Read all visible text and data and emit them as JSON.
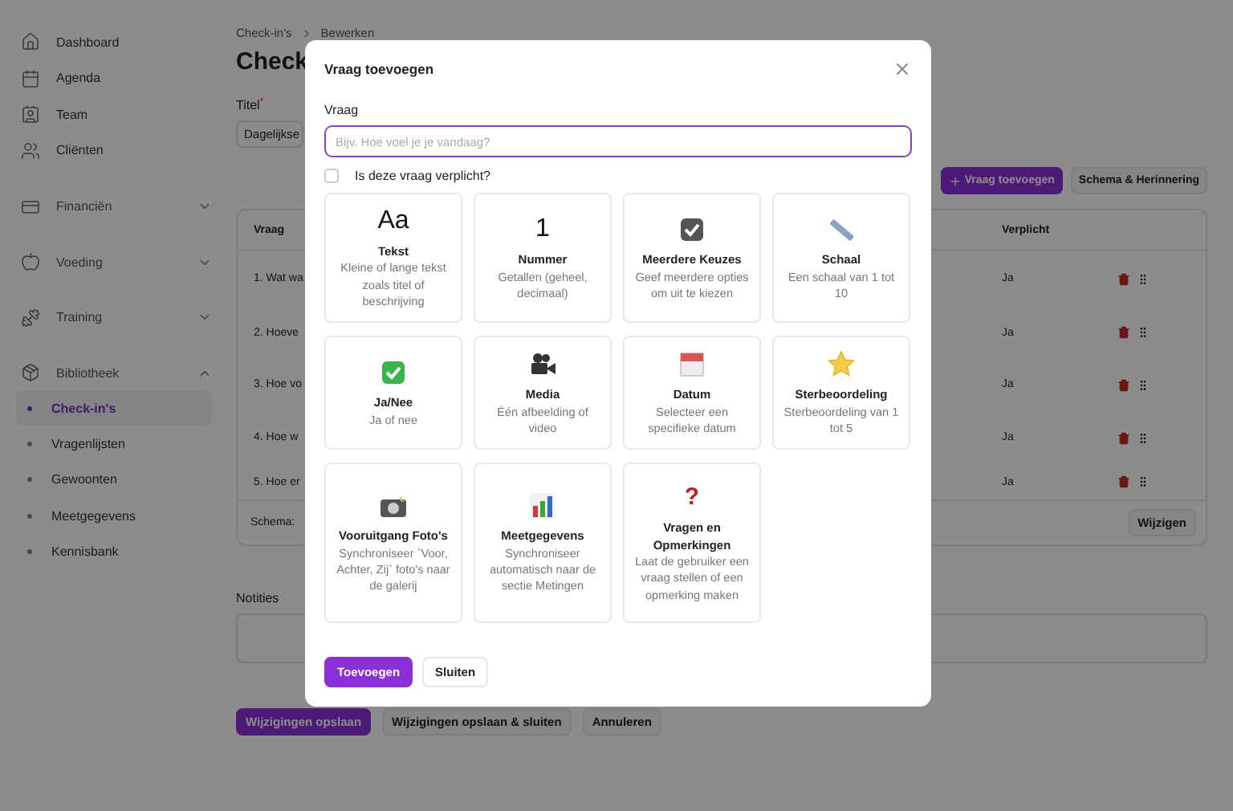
{
  "sidebar": {
    "items": [
      {
        "label": "Dashboard"
      },
      {
        "label": "Agenda"
      },
      {
        "label": "Team"
      },
      {
        "label": "Cliënten"
      }
    ],
    "groups": [
      {
        "label": "Financiën",
        "expanded": false
      },
      {
        "label": "Voeding",
        "expanded": false
      },
      {
        "label": "Training",
        "expanded": false
      },
      {
        "label": "Bibliotheek",
        "expanded": true,
        "children": [
          {
            "label": "Check-in's",
            "selected": true
          },
          {
            "label": "Vragenlijsten",
            "selected": false
          },
          {
            "label": "Gewoonten",
            "selected": false
          },
          {
            "label": "Meetgegevens",
            "selected": false
          },
          {
            "label": "Kennisbank",
            "selected": false
          }
        ]
      }
    ]
  },
  "breadcrumb": [
    "Check-in's",
    "Bewerken"
  ],
  "page_title": "Check",
  "title_field": {
    "label": "Titel",
    "required_mark": "*",
    "value": "Dagelijkse"
  },
  "actions": {
    "add": "Vraag toevoegen",
    "schedule": "Schema & Herinnering"
  },
  "table": {
    "columns": [
      "Vraag",
      "Verplicht"
    ],
    "rows": [
      {
        "question": "1. Wat wa",
        "required": "Ja"
      },
      {
        "question": "2. Hoeve",
        "required": "Ja"
      },
      {
        "question": "3. Hoe vo",
        "required": "Ja"
      },
      {
        "question": "4. Hoe w",
        "required": "Ja"
      },
      {
        "question": "5. Hoe er",
        "required": "Ja"
      }
    ],
    "footer": {
      "label": "Schema:",
      "button": "Wijzigen"
    }
  },
  "notes": {
    "label": "Notities"
  },
  "footer_buttons": [
    {
      "label": "Wijzigingen opslaan",
      "primary": true
    },
    {
      "label": "Wijzigingen opslaan & sluiten",
      "primary": false
    },
    {
      "label": "Annuleren",
      "primary": false
    }
  ],
  "dialog": {
    "title": "Vraag toevoegen",
    "field_label": "Vraag",
    "placeholder": "Bijv. Hoe voel je je vandaag?",
    "required": {
      "label": "Is deze vraag verplicht?",
      "checked": false
    },
    "types": [
      {
        "kind": "glyph",
        "glyph": "Aa",
        "title": "Tekst",
        "description": "Kleine of lange tekst zoals titel of beschrijving"
      },
      {
        "kind": "glyph",
        "glyph": "1",
        "title": "Nummer",
        "description": "Getallen (geheel, decimaal)"
      },
      {
        "kind": "checkbox",
        "title": "Meerdere Keuzes",
        "description": "Geef meerdere opties om uit te kiezen"
      },
      {
        "kind": "ruler",
        "title": "Schaal",
        "description": "Een schaal van 1 tot 10"
      },
      {
        "kind": "check",
        "title": "Ja/Nee",
        "description": "Ja of nee"
      },
      {
        "kind": "camera",
        "title": "Media",
        "description": "Één afbeelding of video"
      },
      {
        "kind": "calendar",
        "title": "Datum",
        "description": "Selecteer een specifieke datum"
      },
      {
        "kind": "star",
        "title": "Sterbeoordeling",
        "description": "Sterbeoordeling van 1 tot 5"
      },
      {
        "kind": "photo",
        "title": "Vooruitgang Foto's",
        "description": "Synchroniseer `Voor, Achter, Zij` foto's naar de galerij"
      },
      {
        "kind": "chart",
        "title": "Meetgegevens",
        "description": "Synchroniseer automatisch naar de sectie Metingen"
      },
      {
        "kind": "question",
        "glyph": "?",
        "title": "Vragen en Opmerkingen",
        "description": "Laat de gebruiker een vraag stellen of een opmerking maken"
      }
    ],
    "buttons": [
      {
        "label": "Toevoegen",
        "primary": true
      },
      {
        "label": "Sluiten",
        "primary": false
      }
    ]
  }
}
